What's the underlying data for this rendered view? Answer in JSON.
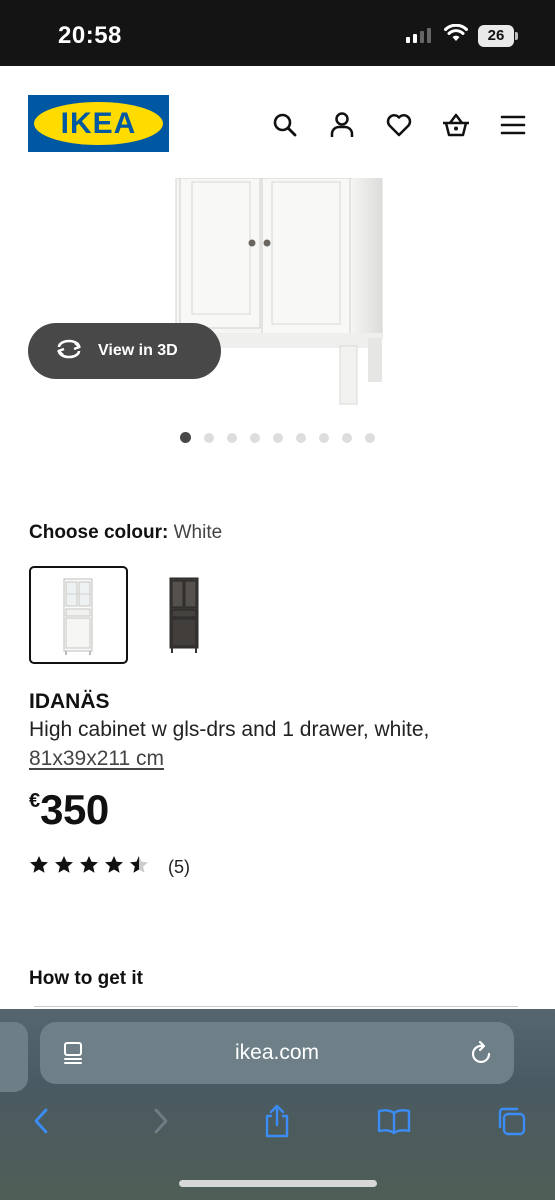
{
  "status": {
    "time": "20:58",
    "battery": "26"
  },
  "header": {
    "logo_text": "IKEA",
    "icons": [
      "search-icon",
      "account-icon",
      "wishlist-heart-icon",
      "shopping-basket-icon",
      "menu-icon"
    ]
  },
  "gallery": {
    "view3d_label": "View in 3D",
    "image_count": 9,
    "active_index": 0
  },
  "colour": {
    "label": "Choose colour:",
    "value": "White",
    "options": [
      "White",
      "Dark grey"
    ]
  },
  "product": {
    "name": "IDANÄS",
    "description": "High cabinet w gls-drs and 1 drawer, white,",
    "dimensions": "81x39x211 cm",
    "currency": "€",
    "price": "350",
    "rating": 4.5,
    "review_count": "(5)"
  },
  "section": {
    "how_to_get": "How to get it"
  },
  "browser": {
    "url": "ikea.com"
  },
  "colors": {
    "ikea_blue": "#0058a3",
    "ikea_yellow": "#ffdb00",
    "pill_bg": "#484848",
    "safari_tint": "#4f5e66"
  }
}
